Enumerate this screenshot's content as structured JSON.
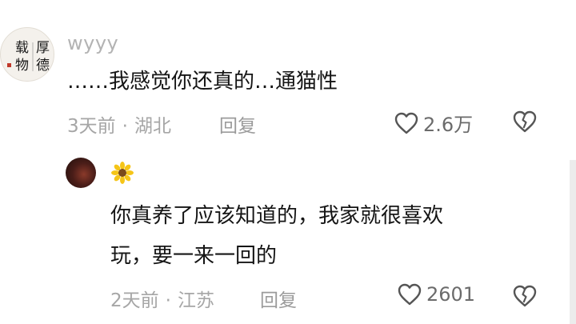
{
  "comments": [
    {
      "username": "wyyy",
      "avatar_text": "厚德载物",
      "text": "……我感觉你还真的…通猫性",
      "time": "3天前",
      "separator": "·",
      "location": "湖北",
      "reply_label": "回复",
      "likes": "2.6万"
    },
    {
      "username_icon": "sunflower-icon",
      "text_line1": "你真养了应该知道的，我家就很喜欢",
      "text_line2": "玩，要一来一回的",
      "time": "2天前",
      "separator": "·",
      "location": "江苏",
      "reply_label": "回复",
      "likes": "2601"
    }
  ],
  "colors": {
    "meta_gray": "#a6a6a6",
    "text_dark": "#151515",
    "icon_gray": "#555555"
  }
}
